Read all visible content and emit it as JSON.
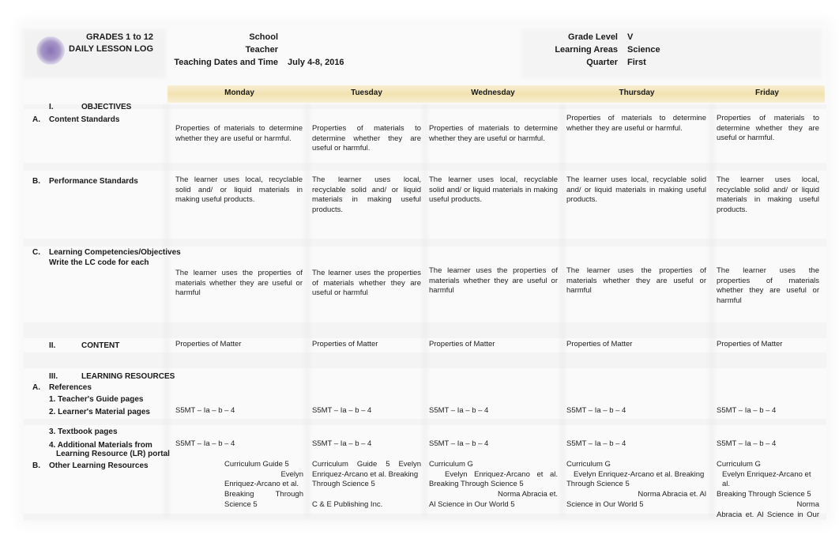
{
  "header": {
    "title_line1": "GRADES 1 to 12",
    "title_line2": "DAILY LESSON LOG",
    "school_label": "School",
    "school_value": "",
    "teacher_label": "Teacher",
    "teacher_value": "",
    "dates_label": "Teaching Dates and Time",
    "dates_value": "July 4-8, 2016",
    "grade_label": "Grade Level",
    "grade_value": "V",
    "area_label": "Learning Areas",
    "area_value": "Science",
    "quarter_label": "Quarter",
    "quarter_value": "First"
  },
  "days": [
    "Monday",
    "Tuesday",
    "Wednesday",
    "Thursday",
    "Friday"
  ],
  "sections": {
    "objectives_num": "I.",
    "objectives_title": "OBJECTIVES",
    "content_standards": {
      "letter": "A.",
      "label": "Content Standards"
    },
    "performance_standards": {
      "letter": "B.",
      "label": "Performance Standards"
    },
    "competencies": {
      "letter": "C.",
      "label": "Learning Competencies/Objectives",
      "sublabel": "Write the LC code for each"
    },
    "content_num": "II.",
    "content_title": "CONTENT",
    "resources_num": "III.",
    "resources_title": "LEARNING RESOURCES",
    "references": {
      "letter": "A.",
      "label": "References"
    },
    "teachers_guide": "1. Teacher's Guide pages",
    "learners_material": "2. Learner's Material pages",
    "textbook": "3. Textbook pages",
    "additional_line1": "4. Additional Materials from",
    "additional_line2": "Learning Resource (LR) portal",
    "other_resources": {
      "letter": "B.",
      "label": "Other Learning Resources"
    }
  },
  "rows": {
    "content_standards": [
      "Properties of materials to determine whether they are useful or harmful.",
      "Properties of materials to determine whether they are useful or harmful.",
      "Properties of materials to determine whether they are useful or harmful.",
      "Properties of materials to determine whether they are useful or harmful.",
      "Properties of materials to determine whether they are useful or harmful."
    ],
    "performance_standards": [
      "The learner uses local, recyclable solid and/ or liquid materials in making useful products.",
      "The learner uses local, recyclable solid and/ or liquid materials in making useful products.",
      "The learner uses local, recyclable solid and/ or liquid materials in making useful products.",
      "The learner uses local, recyclable solid and/ or liquid materials in making useful products.",
      "The learner uses local, recyclable solid and/ or liquid materials in making useful products."
    ],
    "competencies": [
      "The learner uses the properties of materials whether they are useful or harmful",
      "The learner uses the properties of materials whether they are useful or harmful",
      "The learner uses the properties of materials whether they are useful or harmful",
      "The learner uses the properties of materials whether they are useful or harmful",
      "The learner uses the properties of materials whether they are useful or harmful"
    ],
    "content": [
      "Properties of Matter",
      "Properties of Matter",
      "Properties of Matter",
      "Properties of Matter",
      "Properties of Matter"
    ],
    "learners_material": [
      "S5MT – Ia – b – 4",
      "S5MT – Ia – b – 4",
      "S5MT – Ia – b – 4",
      "S5MT – Ia – b – 4",
      "S5MT – Ia – b – 4"
    ],
    "additional_materials": [
      "S5MT – Ia – b – 4",
      "S5MT – Ia – b – 4",
      "S5MT – Ia – b – 4",
      "S5MT – Ia – b – 4",
      "S5MT – Ia – b – 4"
    ],
    "other_resources": [
      {
        "l1": "Curriculum Guide 5",
        "l2": "Evelyn",
        "l3": "Enriquez-Arcano et al.",
        "l4": "Breaking Through",
        "l5": "Science 5"
      },
      {
        "l1": "Curriculum Guide 5 Evelyn",
        "l2": "Enriquez-Arcano et al. Breaking",
        "l3": "Through Science 5",
        "l4": "",
        "l5": "C & E Publishing Inc."
      },
      {
        "l1": "Curriculum G",
        "l2": "Evelyn Enriquez-Arcano et al.",
        "l3": "Breaking Through Science 5",
        "l4": "Norma Abracia et.",
        "l5": "Al Science in Our World 5"
      },
      {
        "l1": "Curriculum G",
        "l2": "Evelyn Enriquez-Arcano et al. Breaking",
        "l3": "Through Science 5",
        "l4": "Norma Abracia et. Al",
        "l5": "Science in Our World 5"
      },
      {
        "l1": "Curriculum G",
        "l2": "Evelyn Enriquez-Arcano et al.",
        "l3": "Breaking Through Science 5",
        "l4": "Norma",
        "l5": "Abracia et. Al Science in Our"
      }
    ]
  }
}
